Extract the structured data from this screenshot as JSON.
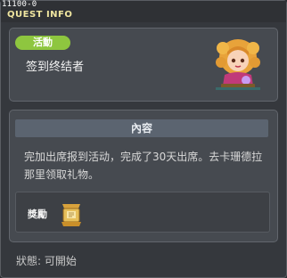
{
  "window": {
    "quest_id": "11100-0",
    "title": "QUEST INFO"
  },
  "quest": {
    "badge": "活動",
    "name": "签到终结者",
    "avatar_icon": "npc-girl-avatar-icon"
  },
  "details": {
    "header": "內容",
    "description": "完加出席报到活动，完成了30天出席。去卡珊德拉那里领取礼物。"
  },
  "reward": {
    "label": "獎勵",
    "icon": "reward-trophy-icon"
  },
  "status": {
    "text": "狀態:  可開始"
  },
  "colors": {
    "badge": "#8ec63f",
    "title": "#f0e6a0",
    "header_bg": "#5b6470"
  }
}
